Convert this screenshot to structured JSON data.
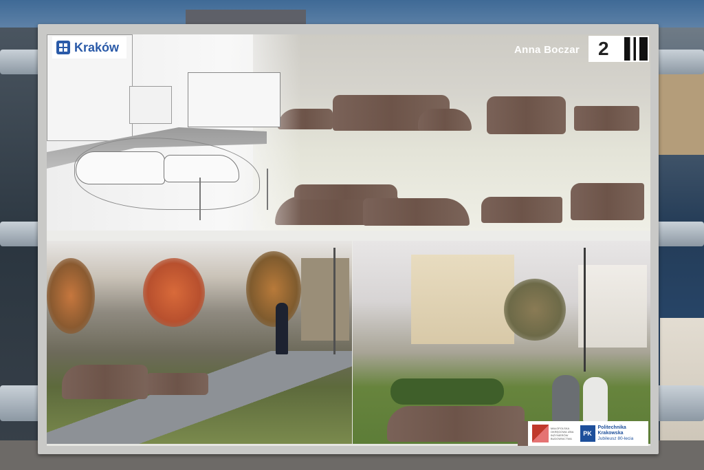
{
  "board": {
    "logo_text": "Kraków",
    "author": "Anna Boczar",
    "number": "2",
    "description": "",
    "footer": {
      "partner_text": "MAŁOPOLSKA OKRĘGOWA IZBA INŻYNIERÓW BUDOWNICTWA",
      "pk_logo_letters": "PK",
      "university_name": "Politechnika Krakowska",
      "university_sub": "Jubileusz 80-lecia"
    }
  },
  "colors": {
    "brand_blue": "#2a5aa8",
    "bench_brown": "#6d5449",
    "board_gray": "#c9c9c7"
  },
  "icons": {
    "logo": "krakow-logo-icon",
    "qr": "qr-code-icon"
  }
}
